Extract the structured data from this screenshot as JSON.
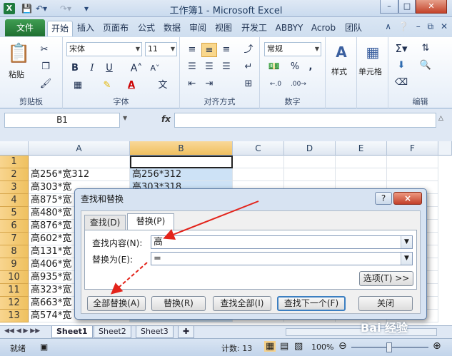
{
  "titlebar": {
    "title": "工作簿1 - Microsoft Excel",
    "app_icon": "X"
  },
  "tabs": {
    "file": "文件",
    "items": [
      "开始",
      "插入",
      "页面布",
      "公式",
      "数据",
      "审阅",
      "视图",
      "开发工",
      "ABBYY",
      "Acrob",
      "团队"
    ]
  },
  "ribbon": {
    "clipboard": {
      "label": "剪贴板",
      "paste": "粘贴"
    },
    "font": {
      "label": "字体",
      "name": "宋体",
      "size": "11",
      "bold": "B",
      "italic": "I",
      "underline": "U"
    },
    "alignment": {
      "label": "对齐方式"
    },
    "number": {
      "label": "数字",
      "format": "常规",
      "percent": "%",
      "comma": ","
    },
    "styles": {
      "label": "样式"
    },
    "cells": {
      "label": "单元格"
    },
    "editing": {
      "label": "编辑"
    }
  },
  "formula_bar": {
    "name_box": "B1",
    "fx": "fx",
    "value": ""
  },
  "columns": [
    "A",
    "B",
    "C",
    "D",
    "E",
    "F"
  ],
  "rows": [
    {
      "n": "1",
      "a": "",
      "b": ""
    },
    {
      "n": "2",
      "a": "高256*宽312",
      "b": "高256*312"
    },
    {
      "n": "3",
      "a": "高303*宽",
      "b": "高303*318"
    },
    {
      "n": "4",
      "a": "高875*宽",
      "b": ""
    },
    {
      "n": "5",
      "a": "高480*宽",
      "b": ""
    },
    {
      "n": "6",
      "a": "高876*宽",
      "b": ""
    },
    {
      "n": "7",
      "a": "高602*宽",
      "b": ""
    },
    {
      "n": "8",
      "a": "高131*宽",
      "b": ""
    },
    {
      "n": "9",
      "a": "高406*宽",
      "b": ""
    },
    {
      "n": "10",
      "a": "高935*宽",
      "b": ""
    },
    {
      "n": "11",
      "a": "高323*宽",
      "b": ""
    },
    {
      "n": "12",
      "a": "高663*宽",
      "b": ""
    },
    {
      "n": "13",
      "a": "高574*宽",
      "b": ""
    }
  ],
  "sheets": [
    "Sheet1",
    "Sheet2",
    "Sheet3"
  ],
  "status": {
    "ready": "就绪",
    "count": "计数: 13",
    "zoom": "100%"
  },
  "dialog": {
    "title": "查找和替换",
    "tab_find": "查找(D)",
    "tab_replace": "替换(P)",
    "find_label": "查找内容(N):",
    "find_value": "高",
    "replace_label": "替换为(E):",
    "replace_value": "=",
    "options": "选项(T) >>",
    "replace_all": "全部替换(A)",
    "replace": "替换(R)",
    "find_all": "查找全部(I)",
    "find_next": "查找下一个(F)",
    "close": "关闭",
    "help": "?",
    "x": "×"
  },
  "watermark": "Bai 经验",
  "colors": {
    "annotation": "#e3241b",
    "accent": "#1f7a3e"
  }
}
